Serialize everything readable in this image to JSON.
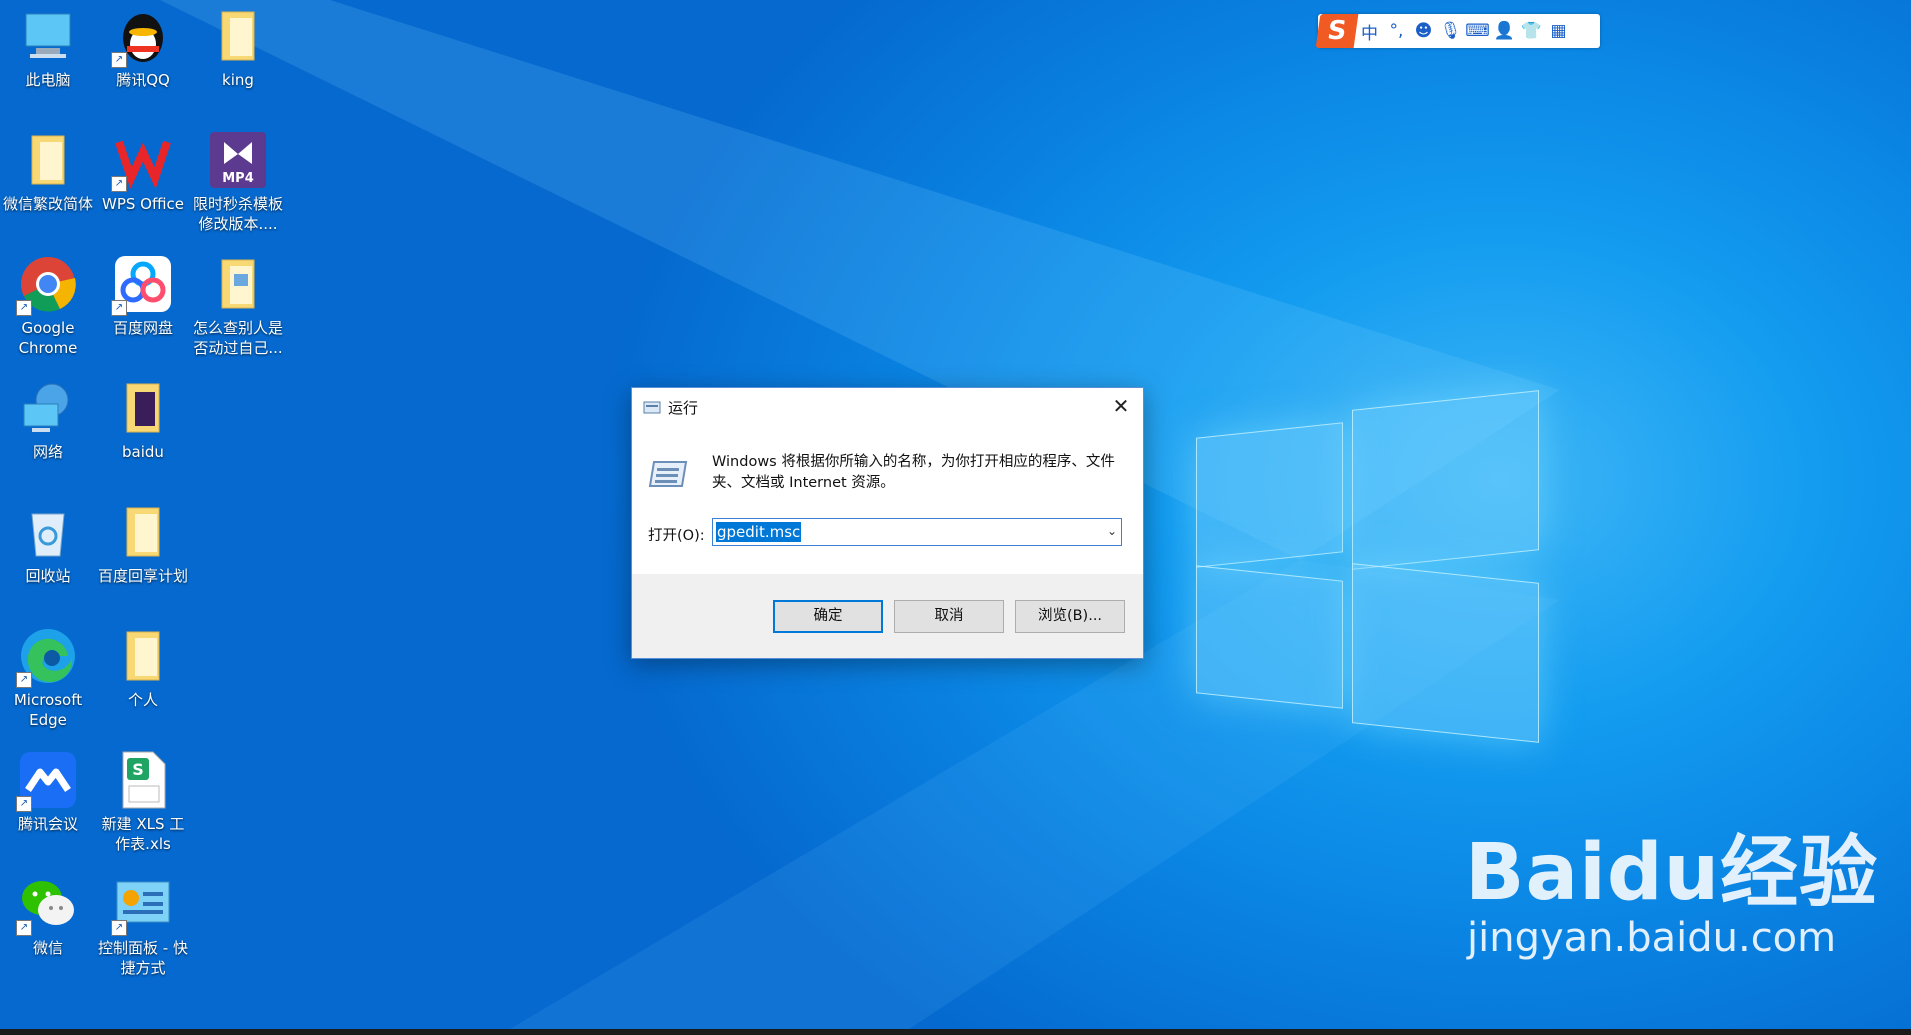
{
  "desktop": {
    "icons": [
      {
        "label": "此电脑",
        "icon": "computer-icon"
      },
      {
        "label": "腾讯QQ",
        "icon": "qq-penguin-icon"
      },
      {
        "label": "king",
        "icon": "folder-icon"
      },
      {
        "label": "微信繁改简体",
        "icon": "folder-icon"
      },
      {
        "label": "WPS Office",
        "icon": "wps-icon"
      },
      {
        "label": "限时秒杀模板修改版本....",
        "icon": "mp4-icon"
      },
      {
        "label": "Google Chrome",
        "icon": "chrome-icon"
      },
      {
        "label": "百度网盘",
        "icon": "baidu-netdisk-icon"
      },
      {
        "label": "怎么查别人是否动过自己...",
        "icon": "folder-icon"
      },
      {
        "label": "网络",
        "icon": "network-icon"
      },
      {
        "label": "baidu",
        "icon": "folder-icon"
      },
      {
        "label": "回收站",
        "icon": "recycle-bin-icon"
      },
      {
        "label": "百度回享计划",
        "icon": "folder-icon"
      },
      {
        "label": "Microsoft Edge",
        "icon": "edge-icon"
      },
      {
        "label": "个人",
        "icon": "folder-icon"
      },
      {
        "label": "腾讯会议",
        "icon": "tencent-meeting-icon"
      },
      {
        "label": "新建 XLS 工作表.xls",
        "icon": "xls-icon"
      },
      {
        "label": "微信",
        "icon": "wechat-icon"
      },
      {
        "label": "控制面板 - 快捷方式",
        "icon": "control-panel-icon"
      }
    ]
  },
  "ime": {
    "mode": "中",
    "punct": "°,"
  },
  "run_dialog": {
    "title": "运行",
    "description": "Windows 将根据你所输入的名称，为你打开相应的程序、文件夹、文档或 Internet 资源。",
    "open_label": "打开(O):",
    "input_value": "gpedit.msc",
    "ok_label": "确定",
    "cancel_label": "取消",
    "browse_label": "浏览(B)..."
  },
  "watermark": {
    "brand": "Baidu经验",
    "url": "jingyan.baidu.com"
  }
}
